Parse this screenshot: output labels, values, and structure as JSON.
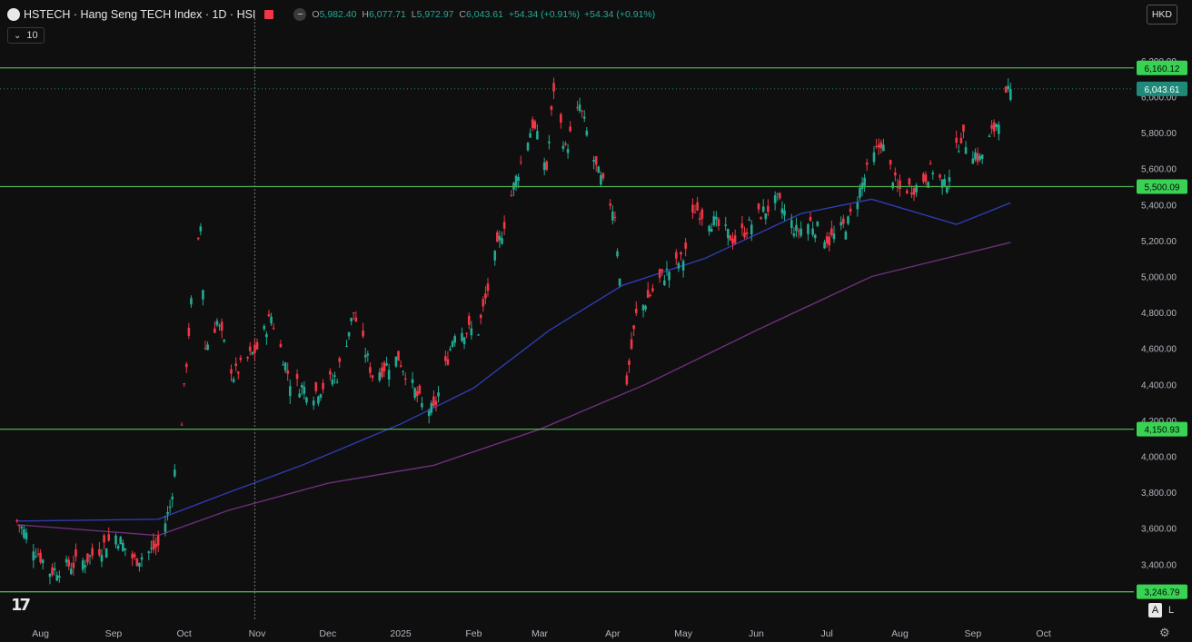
{
  "header": {
    "title": "HSTECH · Hang Seng TECH Index · 1D · HSI",
    "minus_label": "−",
    "o_label": "O",
    "o_val": "5,982.40",
    "h_label": "H",
    "h_val": "6,077.71",
    "l_label": "L",
    "l_val": "5,972.97",
    "c_label": "C",
    "c_val": "6,043.61",
    "chg": "+54.34 (+0.91%)",
    "chg2": "+54.34 (+0.91%)"
  },
  "ma_row": {
    "label": "10",
    "chevron": "⌄"
  },
  "currency": "HKD",
  "logo_text": "17",
  "mode_a": "A",
  "mode_l": "L",
  "settings_icon": "⚙",
  "colors": {
    "up": "#22ab94",
    "down": "#f23645",
    "level": "#4caf50",
    "ma1": "#2f3bb0",
    "ma2": "#6e2f7e",
    "last": "#1f8a7a"
  },
  "chart_data": {
    "type": "candlestick",
    "x_tick_labels": [
      "Aug",
      "Sep",
      "Oct",
      "Nov",
      "Dec",
      "2025",
      "Feb",
      "Mar",
      "Apr",
      "May",
      "Jun",
      "Jul",
      "Aug",
      "Sep",
      "Oct"
    ],
    "y_tick_labels": [
      "3,400.00",
      "3,600.00",
      "3,800.00",
      "4,000.00",
      "4,200.00",
      "4,400.00",
      "4,600.00",
      "4,800.00",
      "5,000.00",
      "5,200.00",
      "5,400.00",
      "5,600.00",
      "5,800.00",
      "6,000.00",
      "6,200.00"
    ],
    "y_ticks": [
      3400,
      3600,
      3800,
      4000,
      4200,
      4400,
      4600,
      4800,
      5000,
      5200,
      5400,
      5600,
      5800,
      6000,
      6200
    ],
    "ylim": [
      3230,
      6260
    ],
    "horizontal_levels": [
      {
        "value": 6160.12,
        "label": "6,160.12"
      },
      {
        "value": 5500.09,
        "label": "5,500.09"
      },
      {
        "value": 4150.93,
        "label": "4,150.93"
      },
      {
        "value": 3246.79,
        "label": "3,246.79"
      }
    ],
    "last_price": {
      "value": 6043.61,
      "label": "6,043.61"
    },
    "close_path": [
      [
        "2024-07-22",
        3640
      ],
      [
        "2024-08-05",
        3360
      ],
      [
        "2024-08-20",
        3420
      ],
      [
        "2024-09-02",
        3560
      ],
      [
        "2024-09-10",
        3420
      ],
      [
        "2024-09-20",
        3500
      ],
      [
        "2024-09-25",
        3720
      ],
      [
        "2024-09-30",
        4200
      ],
      [
        "2024-10-04",
        4850
      ],
      [
        "2024-10-08",
        5280
      ],
      [
        "2024-10-10",
        4600
      ],
      [
        "2024-10-15",
        4750
      ],
      [
        "2024-10-22",
        4450
      ],
      [
        "2024-11-01",
        4600
      ],
      [
        "2024-11-07",
        4780
      ],
      [
        "2024-11-15",
        4420
      ],
      [
        "2024-11-25",
        4350
      ],
      [
        "2024-12-05",
        4450
      ],
      [
        "2024-12-12",
        4800
      ],
      [
        "2024-12-20",
        4450
      ],
      [
        "2024-12-31",
        4550
      ],
      [
        "2025-01-10",
        4280
      ],
      [
        "2025-01-15",
        4250
      ],
      [
        "2025-01-24",
        4700
      ],
      [
        "2025-02-03",
        4700
      ],
      [
        "2025-02-10",
        5100
      ],
      [
        "2025-02-18",
        5500
      ],
      [
        "2025-02-26",
        5850
      ],
      [
        "2025-03-04",
        5600
      ],
      [
        "2025-03-07",
        6050
      ],
      [
        "2025-03-12",
        5700
      ],
      [
        "2025-03-18",
        5950
      ],
      [
        "2025-03-25",
        5600
      ],
      [
        "2025-04-02",
        5350
      ],
      [
        "2025-04-07",
        4420
      ],
      [
        "2025-04-11",
        4780
      ],
      [
        "2025-04-22",
        5000
      ],
      [
        "2025-05-01",
        5100
      ],
      [
        "2025-05-06",
        5380
      ],
      [
        "2025-05-14",
        5300
      ],
      [
        "2025-05-23",
        5200
      ],
      [
        "2025-06-03",
        5350
      ],
      [
        "2025-06-10",
        5420
      ],
      [
        "2025-06-18",
        5250
      ],
      [
        "2025-06-24",
        5300
      ],
      [
        "2025-07-02",
        5200
      ],
      [
        "2025-07-10",
        5300
      ],
      [
        "2025-07-17",
        5550
      ],
      [
        "2025-07-24",
        5750
      ],
      [
        "2025-07-31",
        5480
      ],
      [
        "2025-08-08",
        5500
      ],
      [
        "2025-08-15",
        5600
      ],
      [
        "2025-08-20",
        5500
      ],
      [
        "2025-08-27",
        5780
      ],
      [
        "2025-09-04",
        5650
      ],
      [
        "2025-09-10",
        5820
      ],
      [
        "2025-09-15",
        5990
      ],
      [
        "2025-09-17",
        6043.61
      ]
    ],
    "first_candle_date": "2024-07-22",
    "last_candle": {
      "date": "2025-09-17",
      "open": 5982.4,
      "high": 6077.71,
      "low": 5972.97,
      "close": 6043.61
    },
    "ma_slow": [
      [
        "2024-07-22",
        3620
      ],
      [
        "2024-09-20",
        3560
      ],
      [
        "2024-10-20",
        3700
      ],
      [
        "2024-12-01",
        3850
      ],
      [
        "2025-01-15",
        3950
      ],
      [
        "2025-03-01",
        4150
      ],
      [
        "2025-04-15",
        4400
      ],
      [
        "2025-06-01",
        4700
      ],
      [
        "2025-07-20",
        5000
      ],
      [
        "2025-09-17",
        5190
      ]
    ],
    "ma_fast": [
      [
        "2024-07-22",
        3640
      ],
      [
        "2024-09-20",
        3650
      ],
      [
        "2024-10-20",
        3800
      ],
      [
        "2024-11-20",
        3950
      ],
      [
        "2025-01-01",
        4180
      ],
      [
        "2025-02-01",
        4380
      ],
      [
        "2025-03-05",
        4700
      ],
      [
        "2025-04-05",
        4950
      ],
      [
        "2025-05-10",
        5100
      ],
      [
        "2025-06-20",
        5350
      ],
      [
        "2025-07-20",
        5430
      ],
      [
        "2025-08-25",
        5290
      ],
      [
        "2025-09-17",
        5410
      ]
    ],
    "crosshair_date": "2024-10-31"
  }
}
